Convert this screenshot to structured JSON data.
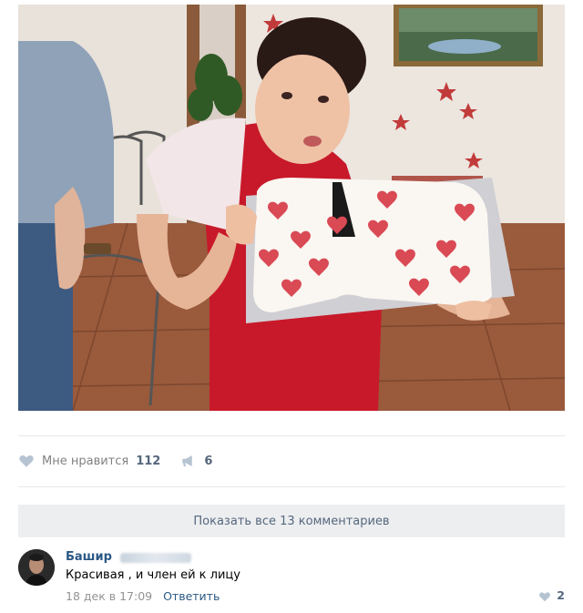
{
  "post": {
    "likes_label": "Мне нравится",
    "likes_count": "112",
    "shares_count": "6"
  },
  "comments": {
    "show_all_label": "Показать все 13 комментариев",
    "items": [
      {
        "author": "Башир",
        "text": "Красивая , и член ей к лицу",
        "date": "18 дек в 17:09",
        "reply_label": "Ответить",
        "likes": "2"
      }
    ]
  },
  "colors": {
    "link": "#2a5885",
    "muted": "#828282",
    "count": "#55677d",
    "bar_bg": "#edeef0"
  },
  "icons": {
    "like": "heart-icon",
    "share": "megaphone-icon",
    "comment_like": "heart-icon"
  }
}
